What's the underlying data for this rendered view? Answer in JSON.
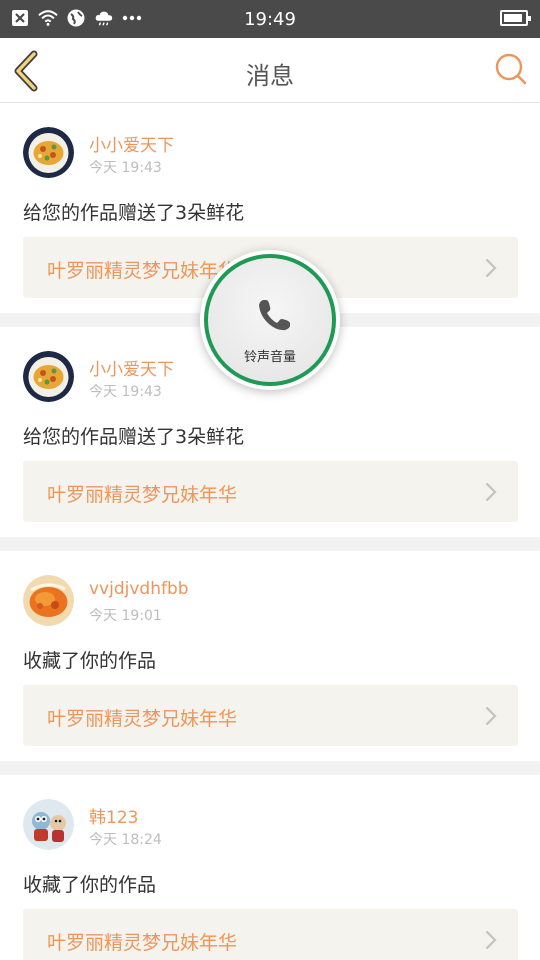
{
  "status_bar": {
    "time": "19:49",
    "icons": [
      "close-box-icon",
      "wifi-icon",
      "globe-icon",
      "cloud-icon",
      "more-dots-icon",
      "battery-icon"
    ]
  },
  "header": {
    "title": "消息",
    "back_icon": "chevron-left-icon",
    "search_icon": "search-icon"
  },
  "colors": {
    "accent": "#f0955a",
    "ring_border": "#1e9a55",
    "link_bg": "#f4f3ee"
  },
  "messages": [
    {
      "username": "小小爱天下",
      "time": "今天 19:43",
      "action": "给您的作品赠送了3朵鲜花",
      "work": "叶罗丽精灵梦兄妹年华",
      "avatar": "food-dish"
    },
    {
      "username": "小小爱天下",
      "time": "今天 19:43",
      "action": "给您的作品赠送了3朵鲜花",
      "work": "叶罗丽精灵梦兄妹年华",
      "avatar": "food-dish"
    },
    {
      "username": "vvjdjvdhfbb",
      "time": "今天 19:01",
      "action": "收藏了你的作品",
      "work": "叶罗丽精灵梦兄妹年华",
      "avatar": "orange-dish"
    },
    {
      "username": "韩123",
      "time": "今天 18:24",
      "action": "收藏了你的作品",
      "work": "叶罗丽精灵梦兄妹年华",
      "avatar": "toy-figures"
    }
  ],
  "ring_overlay": {
    "label": "铃声音量",
    "icon": "phone-icon"
  }
}
